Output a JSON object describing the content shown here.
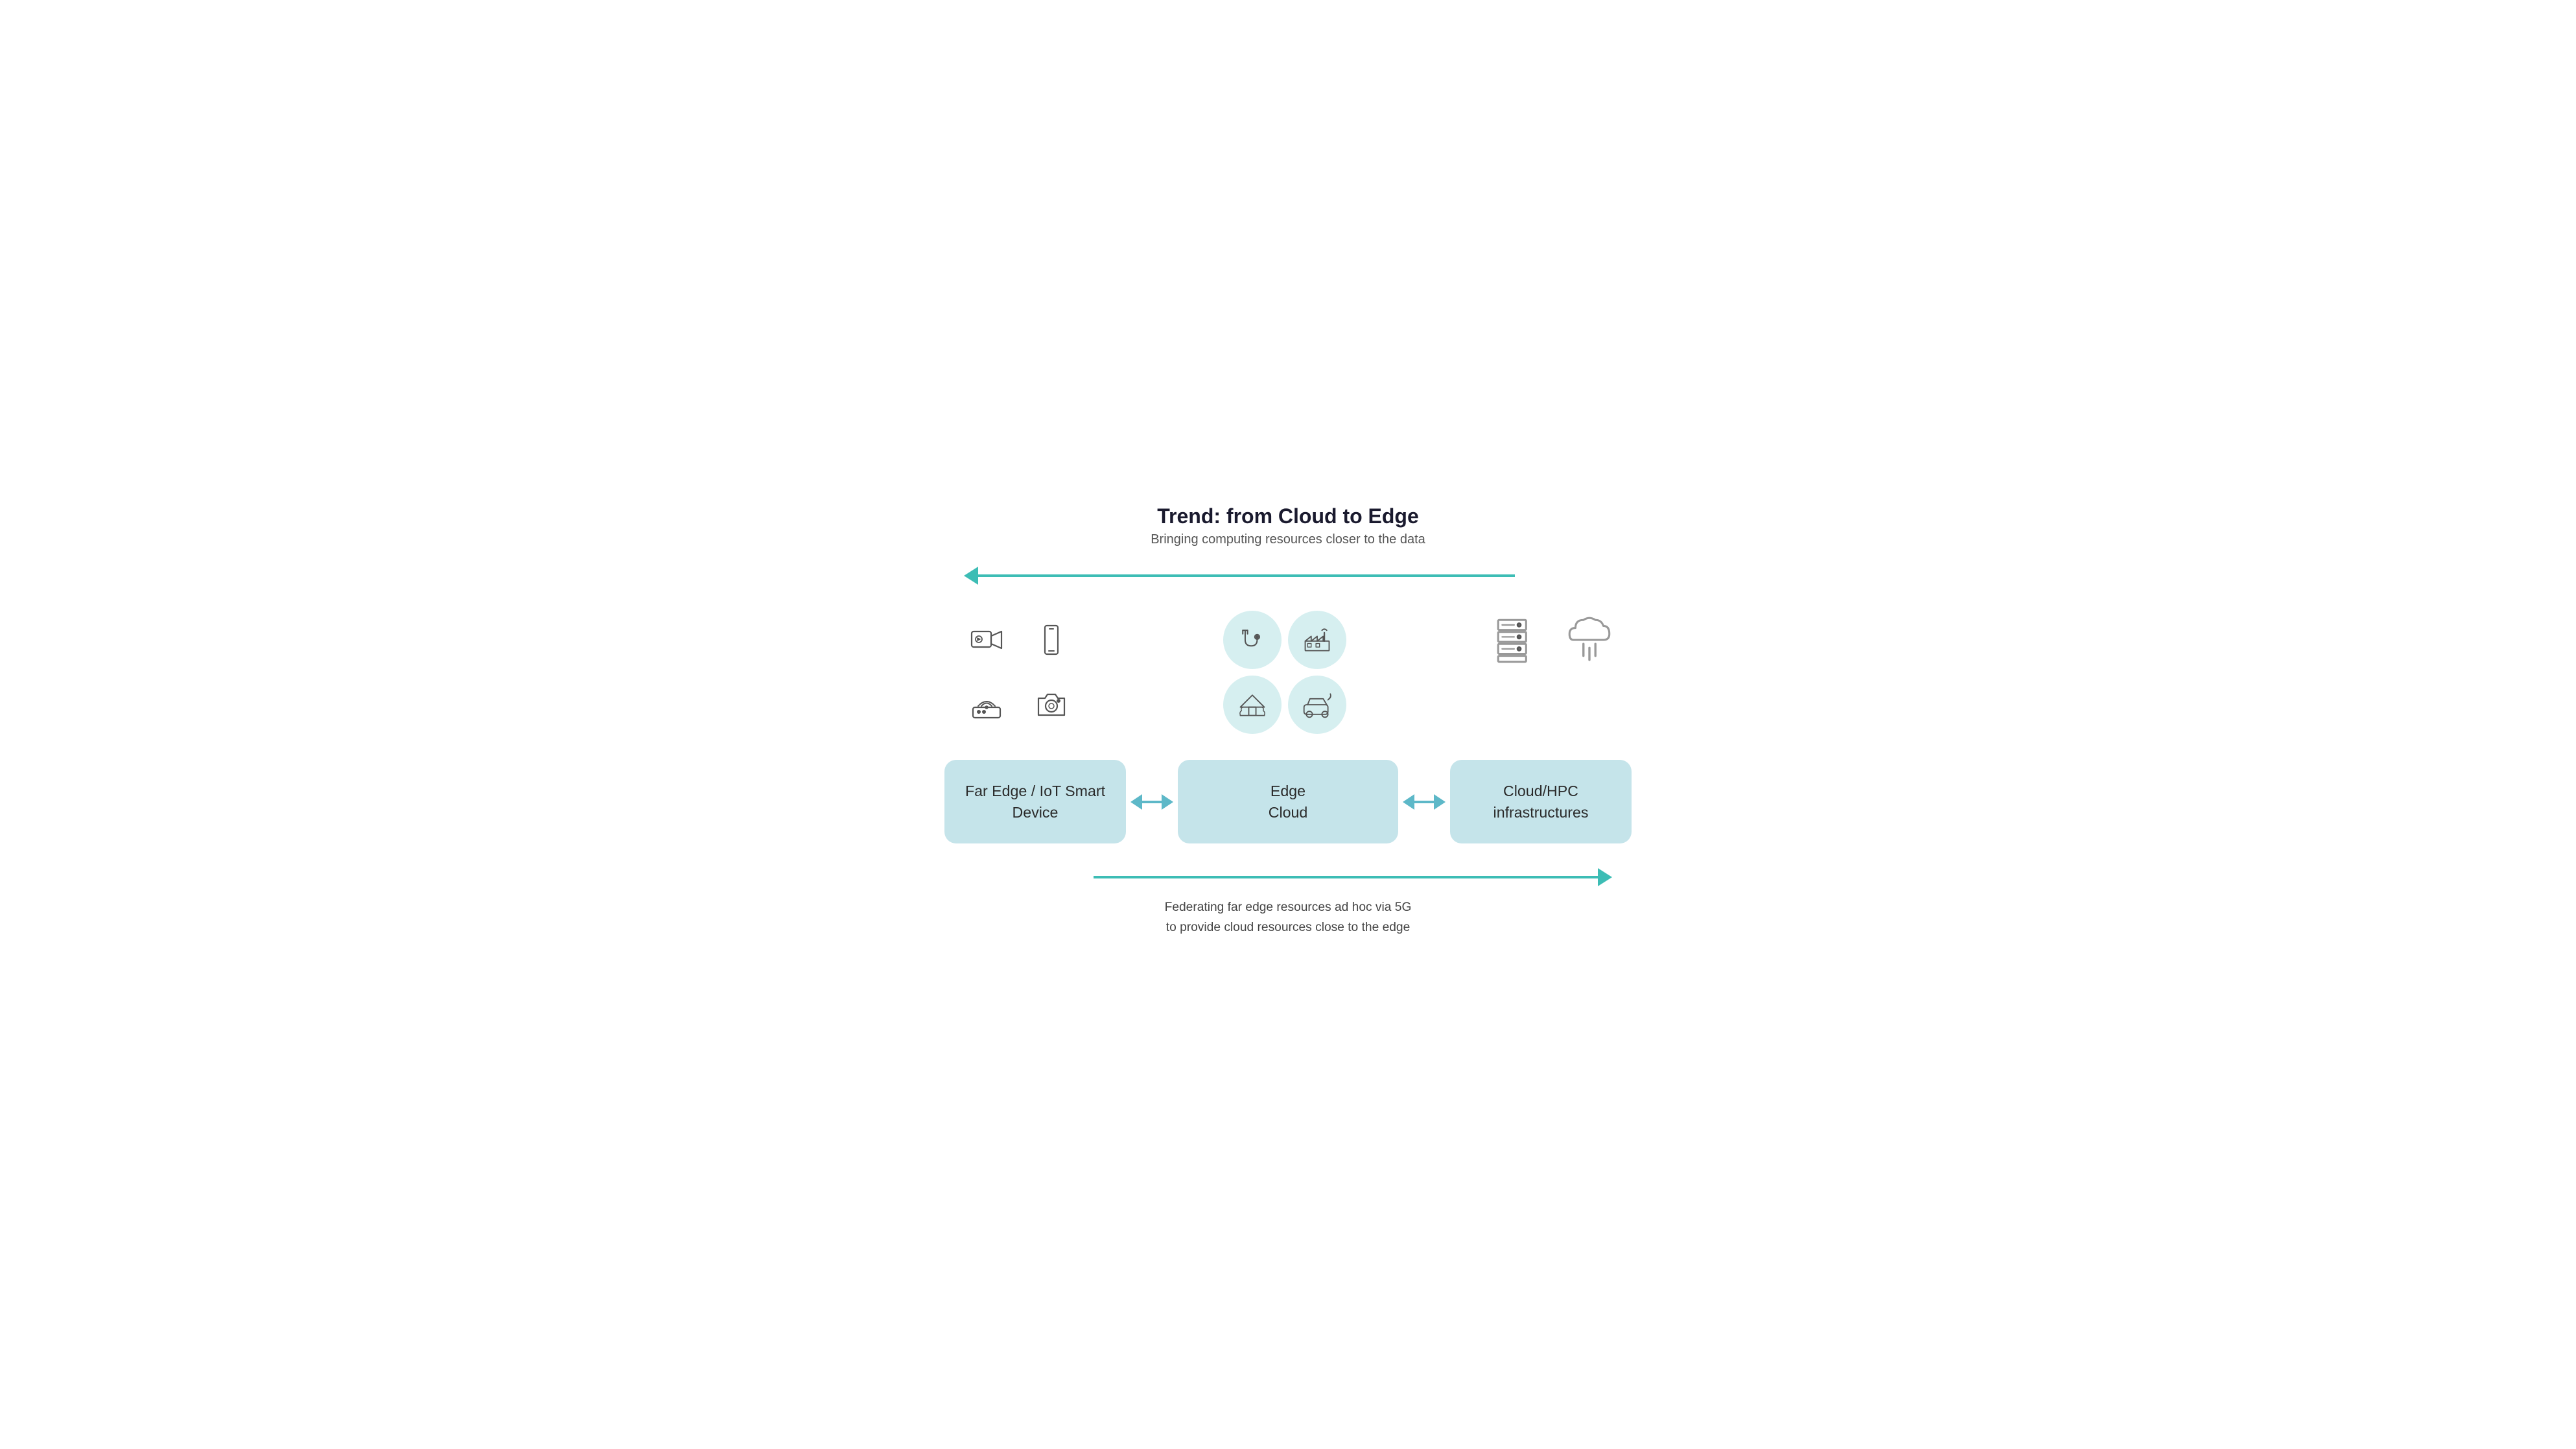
{
  "header": {
    "title": "Trend: from Cloud to Edge",
    "subtitle": "Bringing computing resources closer to the data"
  },
  "top_arrow": {
    "direction": "left"
  },
  "icon_groups": {
    "far_edge_icons": [
      "video-camera",
      "smartphone",
      "router",
      "camera"
    ],
    "edge_cloud_icons": [
      "stethoscope",
      "factory",
      "farm",
      "electric-car"
    ],
    "cloud_hpc_icons": [
      "server-rack",
      "cloud-data"
    ]
  },
  "boxes": [
    {
      "label": "Far Edge / IoT Smart\nDevice",
      "id": "far-edge-box"
    },
    {
      "label": "Edge\nCloud",
      "id": "edge-cloud-box"
    },
    {
      "label": "Cloud/HPC\ninfrastructures",
      "id": "cloud-hpc-box"
    }
  ],
  "bottom_arrow": {
    "direction": "right"
  },
  "bottom_text": "Federating far edge resources ad hoc via 5G\nto provide cloud resources close to the edge",
  "colors": {
    "accent": "#3dbdb5",
    "box_bg": "#c5e4ea",
    "icon_bg": "#d6eff0",
    "connector": "#5db8c8",
    "text_dark": "#1a1a2e",
    "text_medium": "#555"
  }
}
